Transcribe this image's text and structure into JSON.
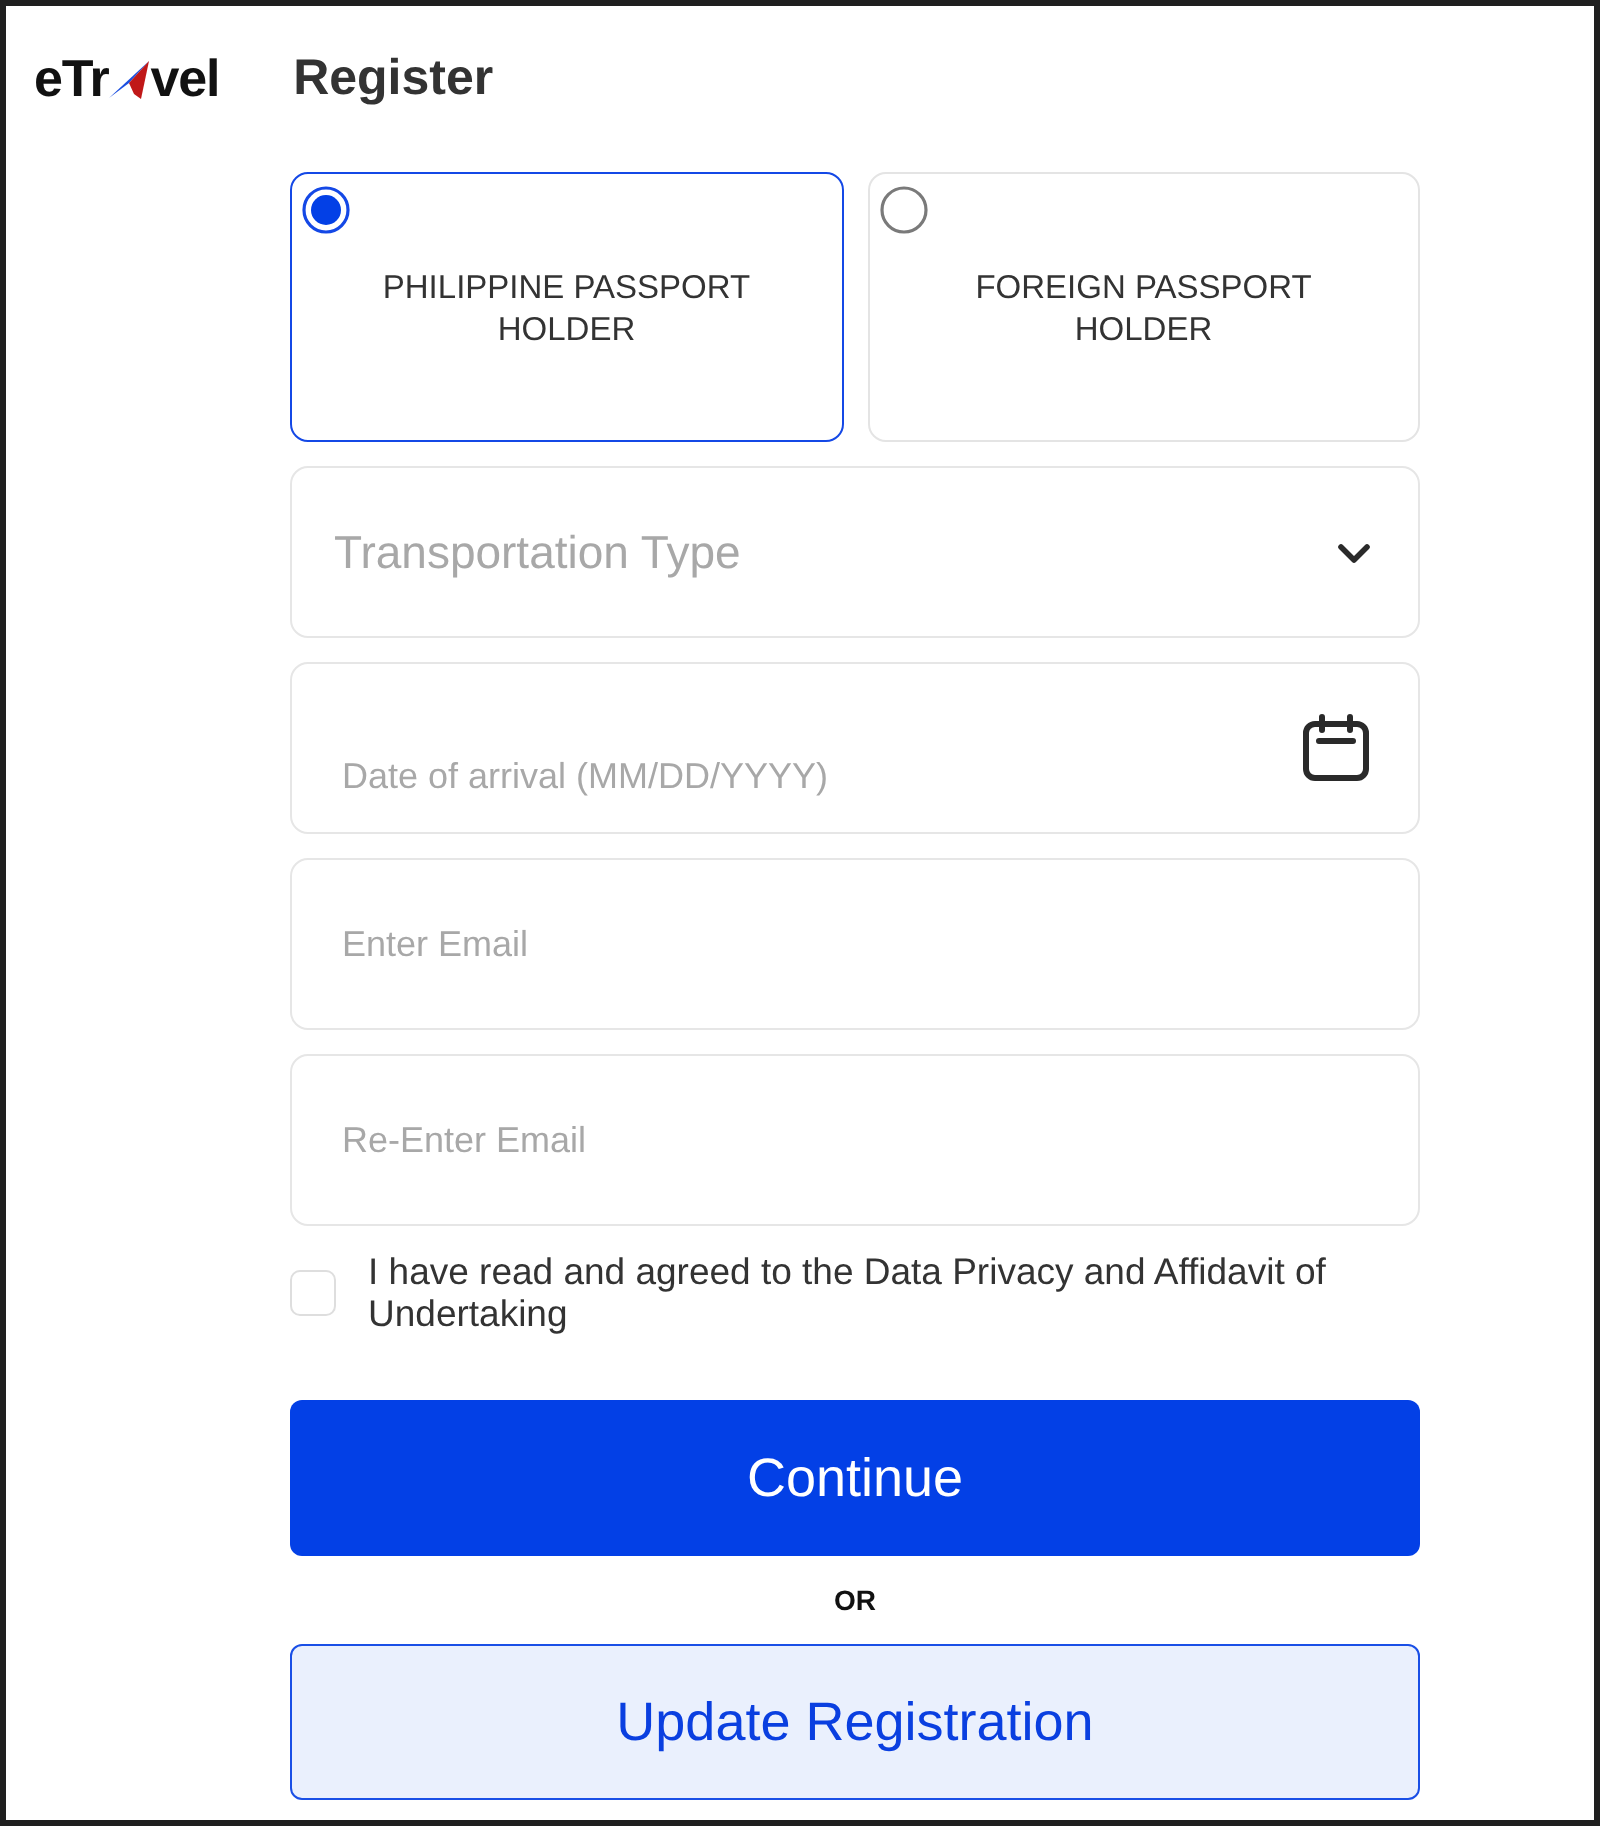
{
  "header": {
    "logo_start": "eTr",
    "logo_end": "vel",
    "title": "Register"
  },
  "passport_options": [
    {
      "label": "PHILIPPINE PASSPORT HOLDER",
      "selected": true
    },
    {
      "label": "FOREIGN PASSPORT HOLDER",
      "selected": false
    }
  ],
  "fields": [
    {
      "kind": "select",
      "placeholder": "Transportation Type"
    },
    {
      "kind": "date",
      "placeholder": "Date of arrival (MM/DD/YYYY)"
    },
    {
      "kind": "text",
      "placeholder": "Enter Email"
    },
    {
      "kind": "text",
      "placeholder": "Re-Enter Email"
    }
  ],
  "agreement": {
    "label": "I have read and agreed to the Data Privacy and Affidavit of Undertaking",
    "checked": false
  },
  "primary_button": "Continue",
  "separator": "OR",
  "secondary_button": "Update Registration"
}
